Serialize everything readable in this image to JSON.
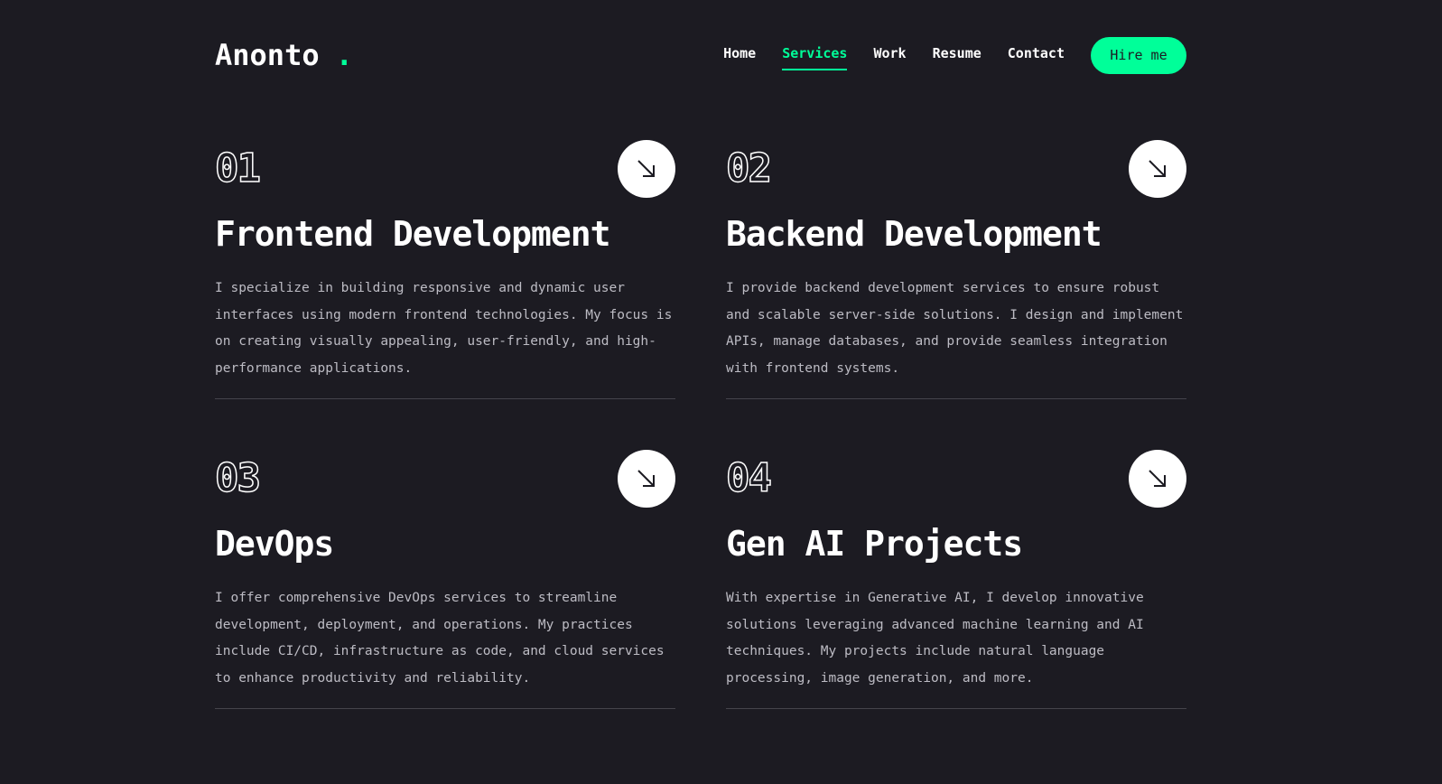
{
  "header": {
    "logo_text": "Anonto",
    "logo_dot": ".",
    "nav": [
      {
        "label": "Home",
        "active": false
      },
      {
        "label": "Services",
        "active": true
      },
      {
        "label": "Work",
        "active": false
      },
      {
        "label": "Resume",
        "active": false
      },
      {
        "label": "Contact",
        "active": false
      }
    ],
    "hire_label": "Hire me"
  },
  "services": [
    {
      "number": "01",
      "title": "Frontend Development",
      "description": "I specialize in building responsive and dynamic user interfaces using modern frontend technologies. My focus is on creating visually appealing, user-friendly, and high-performance applications."
    },
    {
      "number": "02",
      "title": "Backend Development",
      "description": "I provide backend development services to ensure robust and scalable server-side solutions. I design and implement APIs, manage databases, and provide seamless integration with frontend systems."
    },
    {
      "number": "03",
      "title": "DevOps",
      "description": "I offer comprehensive DevOps services to streamline development, deployment, and operations. My practices include CI/CD, infrastructure as code, and cloud services to enhance productivity and reliability."
    },
    {
      "number": "04",
      "title": "Gen AI Projects",
      "description": "With expertise in Generative AI, I develop innovative solutions leveraging advanced machine learning and AI techniques. My projects include natural language processing, image generation, and more."
    }
  ],
  "colors": {
    "background": "#1c1b22",
    "accent": "#00ff99",
    "text": "#ffffff",
    "muted_text": "#bdbcc4"
  },
  "icons": {
    "service_link": "arrow-down-right-icon"
  }
}
